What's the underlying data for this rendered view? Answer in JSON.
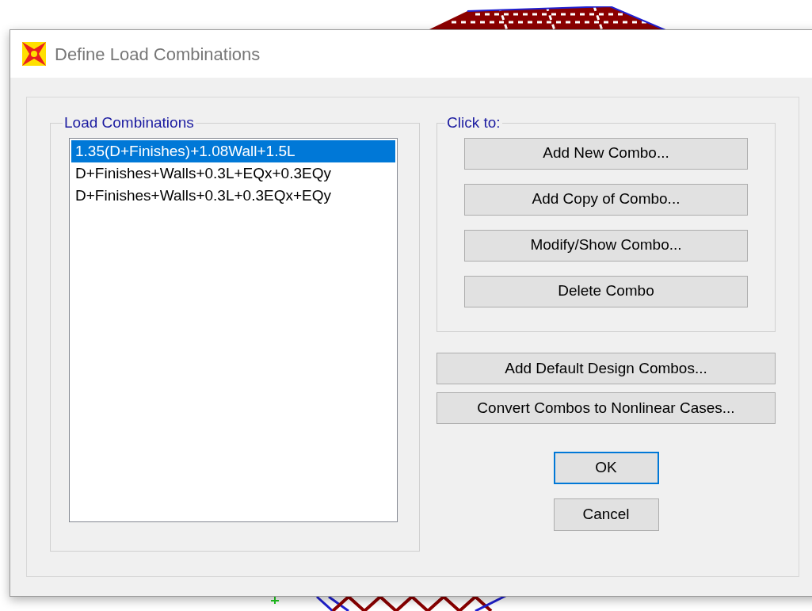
{
  "window": {
    "title": "Define Load Combinations"
  },
  "combinations": {
    "label": "Load Combinations",
    "items": [
      {
        "label": "1.35(D+Finishes)+1.08Wall+1.5L",
        "selected": true
      },
      {
        "label": "D+Finishes+Walls+0.3L+EQx+0.3EQy",
        "selected": false
      },
      {
        "label": "D+Finishes+Walls+0.3L+0.3EQx+EQy",
        "selected": false
      }
    ]
  },
  "click_to": {
    "label": "Click to:",
    "buttons": [
      "Add New Combo...",
      "Add Copy of Combo...",
      "Modify/Show Combo...",
      "Delete Combo"
    ]
  },
  "wide_buttons": [
    "Add Default Design Combos...",
    "Convert Combos to Nonlinear Cases..."
  ],
  "dialog_buttons": [
    {
      "label": "OK",
      "default": true
    },
    {
      "label": "Cancel",
      "default": false
    }
  ]
}
